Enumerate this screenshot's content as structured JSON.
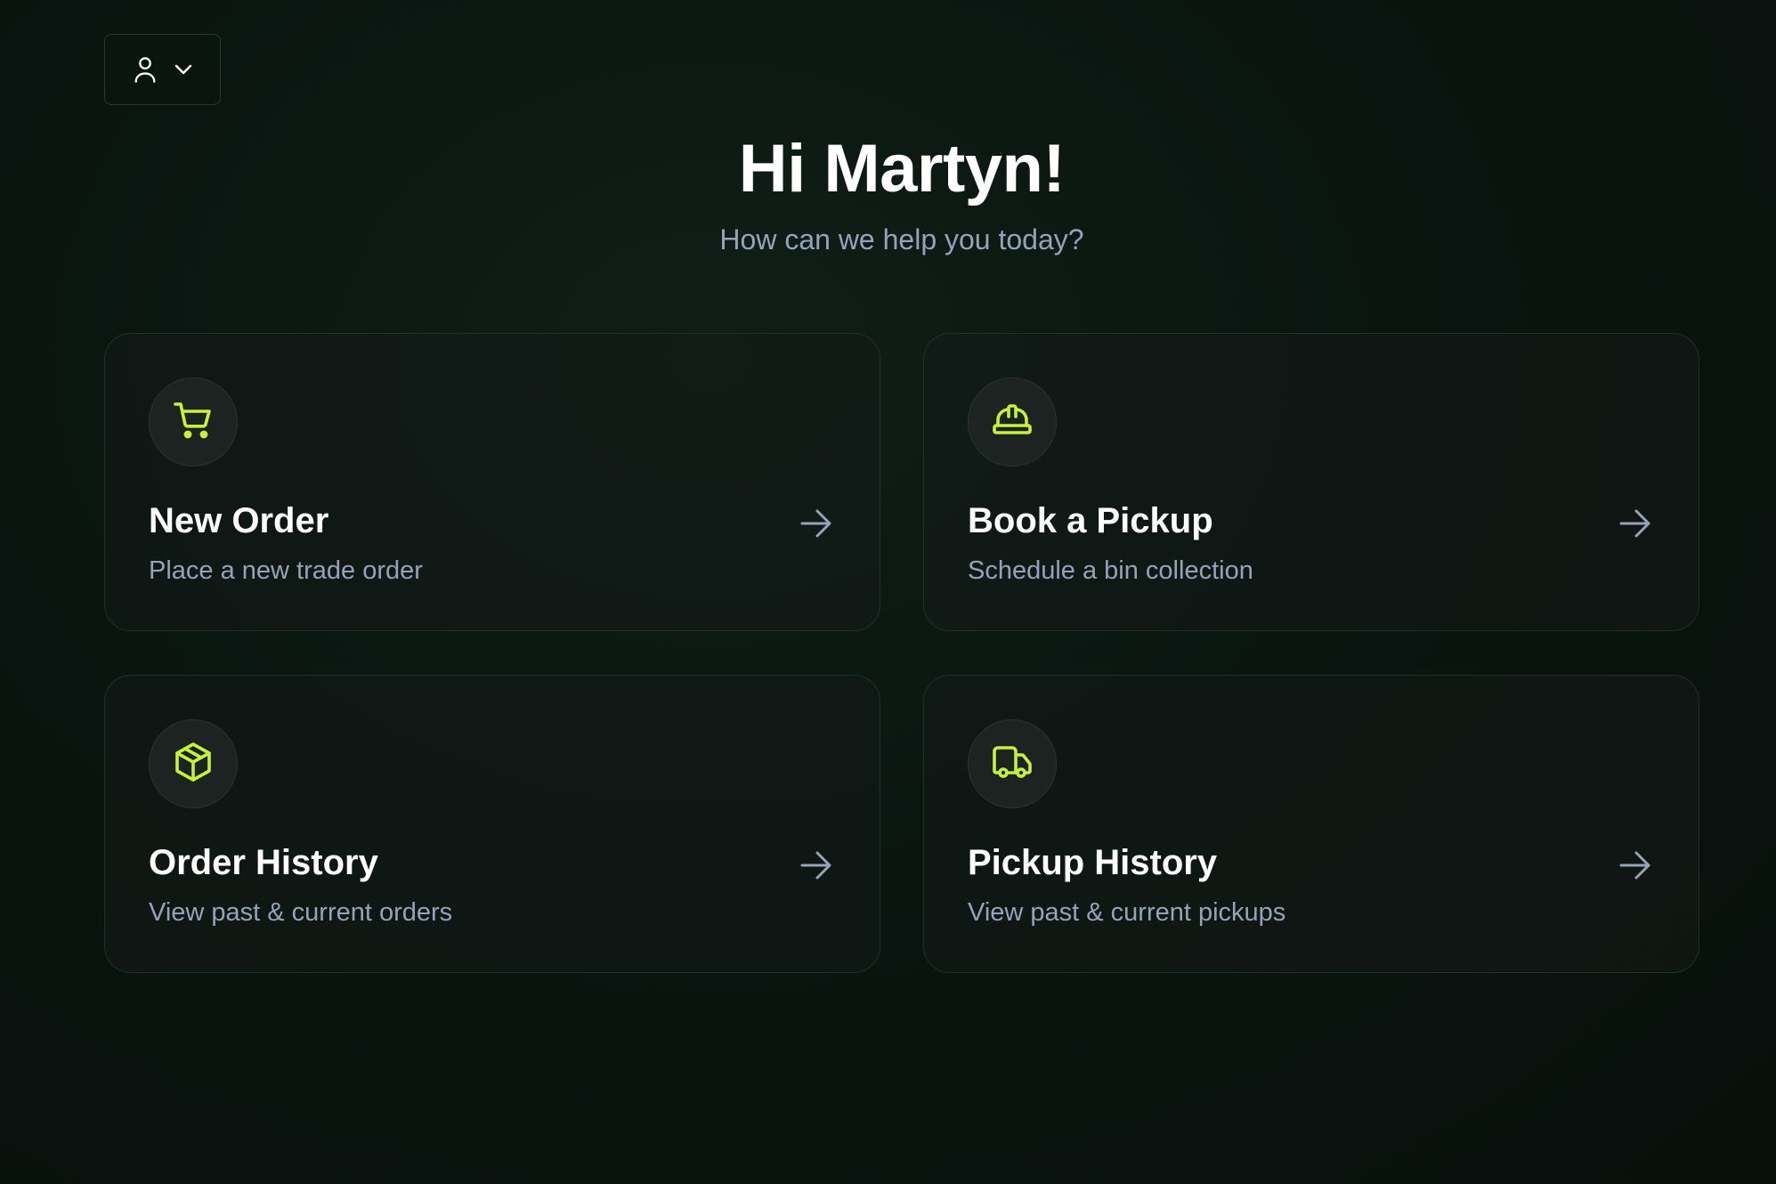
{
  "colors": {
    "accent": "#c6f23a",
    "muted_text": "#94a3b8",
    "card_border": "#1f3325"
  },
  "user_menu": {
    "icon": "user-icon",
    "caret_icon": "chevron-down-icon"
  },
  "header": {
    "greeting": "Hi Martyn!",
    "subtitle": "How can we help you today?"
  },
  "cards": [
    {
      "icon": "cart-icon",
      "title": "New Order",
      "description": "Place a new trade order"
    },
    {
      "icon": "hard-hat-icon",
      "title": "Book a Pickup",
      "description": "Schedule a bin collection"
    },
    {
      "icon": "package-icon",
      "title": "Order History",
      "description": "View past & current orders"
    },
    {
      "icon": "truck-icon",
      "title": "Pickup History",
      "description": "View past & current pickups"
    }
  ]
}
